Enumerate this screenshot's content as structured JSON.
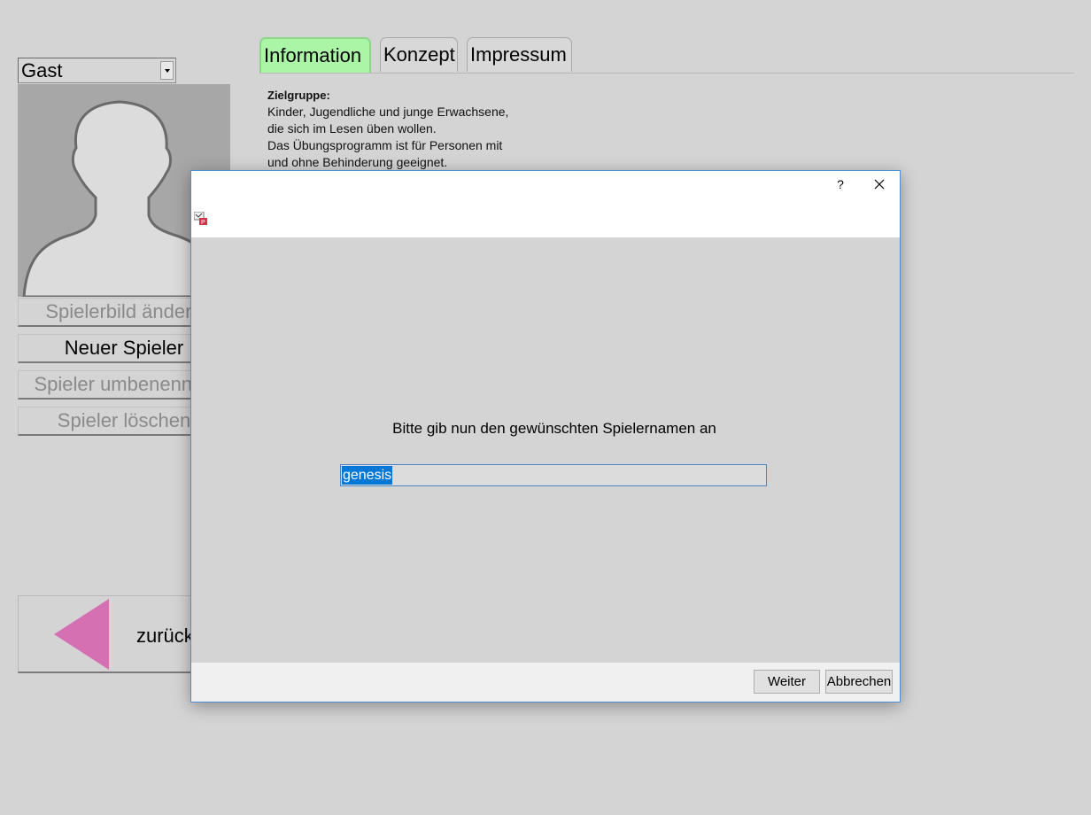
{
  "player": {
    "selected": "Gast",
    "buttons": {
      "change_picture": "Spielerbild ändern",
      "new_player": "Neuer Spieler",
      "rename_player": "Spieler umbenennen",
      "delete_player": "Spieler löschen"
    },
    "back_label": "zurück"
  },
  "tabs": [
    {
      "label": "Information",
      "active": true
    },
    {
      "label": "Konzept",
      "active": false
    },
    {
      "label": "Impressum",
      "active": false
    }
  ],
  "info": {
    "heading": "Zielgruppe:",
    "lines": [
      "Kinder, Jugendliche und junge Erwachsene,",
      "die sich im Lesen üben wollen.",
      "Das Übungsprogramm ist für Personen mit",
      "und ohne Behinderung geeignet."
    ]
  },
  "dialog": {
    "help_label": "?",
    "prompt": "Bitte gib nun den gewünschten Spielernamen an",
    "input_value": "genesis",
    "next_label": "Weiter",
    "cancel_label": "Abbrechen"
  },
  "colors": {
    "active_tab": "#aaf5a6",
    "back_arrow": "#d571b3",
    "selection": "#0078d7"
  }
}
